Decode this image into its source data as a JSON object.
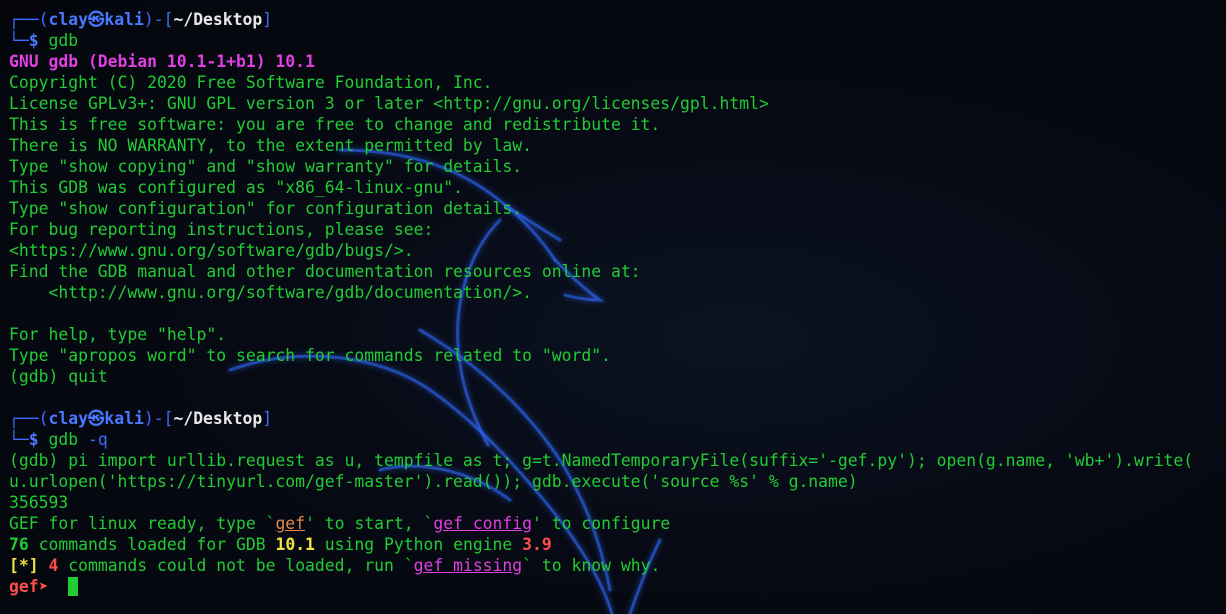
{
  "colors": {
    "background": "#05070d",
    "text_green": "#22cc33",
    "prompt_blue": "#3d6bff",
    "magenta": "#e040e0",
    "yellow": "#f0e040",
    "red": "#ff4d4d",
    "orange": "#e28a4a",
    "dragon_glow": "#2d6cff"
  },
  "background_image": "kali-dragon-icon",
  "prompt1": {
    "corner": "┌──(",
    "user": "clay",
    "at": "㉿",
    "host": "kali",
    "mid": ")-[",
    "path": "~/Desktop",
    "end": "]",
    "arrow": "└─",
    "dollar": "$ ",
    "command": "gdb"
  },
  "gdb_banner": {
    "title": "GNU gdb (Debian 10.1-1+b1) 10.1",
    "lines": [
      "Copyright (C) 2020 Free Software Foundation, Inc.",
      "License GPLv3+: GNU GPL version 3 or later <http://gnu.org/licenses/gpl.html>",
      "This is free software: you are free to change and redistribute it.",
      "There is NO WARRANTY, to the extent permitted by law.",
      "Type \"show copying\" and \"show warranty\" for details.",
      "This GDB was configured as \"x86_64-linux-gnu\".",
      "Type \"show configuration\" for configuration details.",
      "For bug reporting instructions, please see:",
      "<https://www.gnu.org/software/gdb/bugs/>.",
      "Find the GDB manual and other documentation resources online at:",
      "    <http://www.gnu.org/software/gdb/documentation/>."
    ],
    "help_lines": [
      "For help, type \"help\".",
      "Type \"apropos word\" to search for commands related to \"word\".",
      "(gdb) quit"
    ]
  },
  "prompt2": {
    "corner": "┌──(",
    "user": "clay",
    "at": "㉿",
    "host": "kali",
    "mid": ")-[",
    "path": "~/Desktop",
    "end": "]",
    "arrow": "└─",
    "dollar": "$ ",
    "command": "gdb",
    "flag": " -q"
  },
  "session": {
    "pi_line_1": "(gdb) pi import urllib.request as u, tempfile as t; g=t.NamedTemporaryFile(suffix='-gef.py'); open(g.name, 'wb+').write(",
    "pi_line_2": "u.urlopen('https://tinyurl.com/gef-master').read()); gdb.execute('source %s' % g.name)",
    "bytes_written": "356593",
    "gef_ready": {
      "p1": "GEF for linux ready, type `",
      "gef": "gef",
      "p2": "' to start, `",
      "gef_config": "gef config",
      "p3": "' to configure"
    },
    "commands_loaded": {
      "count": "76",
      "p1": " commands loaded for GDB ",
      "gdb_version": "10.1",
      "p2": " using Python engine ",
      "python_version": "3.9"
    },
    "missing": {
      "tag": "[*]",
      "space": " ",
      "count": "4",
      "p1": " commands could not be loaded, run `",
      "cmd": "gef missing",
      "p2": "` to know why."
    },
    "gef_prompt": "gef➤ ",
    "prompt_gap": " "
  }
}
